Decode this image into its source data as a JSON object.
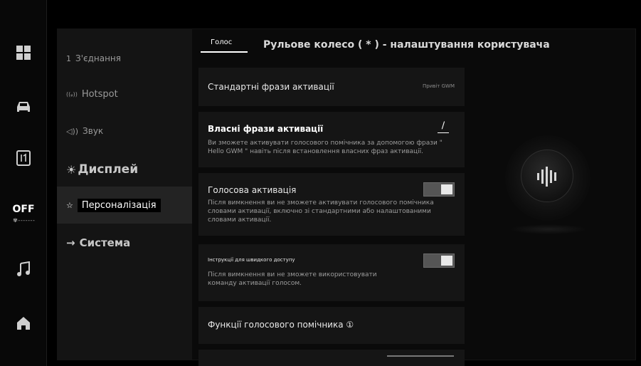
{
  "rail": {
    "ac_status": "OFF",
    "ac_fan_dots": "✾ - - - - - - -"
  },
  "menu": {
    "items": [
      {
        "label": "З'єднання",
        "icon_text": "1"
      },
      {
        "label": "Hotspot",
        "icon_text": "((ᵩ))"
      },
      {
        "label": "Звук",
        "icon_text": "◁))"
      },
      {
        "label": "Дисплей",
        "icon_text": "☀"
      },
      {
        "label": "Персоналізація",
        "icon_text": "☆"
      },
      {
        "label": "Система",
        "icon_text": "→"
      }
    ]
  },
  "header": {
    "tab_label": "Голос",
    "title": "Рульове колесо ( * ) - налаштування користувача"
  },
  "cards": {
    "standard_phrases": {
      "title": "Стандартні фрази активації",
      "value": "Привіт GWM"
    },
    "custom_phrases": {
      "title": "Власні фрази активації",
      "edit_glyph": "∕",
      "desc": "Ви зможете активувати голосового помічника за допомогою фрази \" Hello GWM \" навіть після встановлення власних фраз активації."
    },
    "voice_activation": {
      "title": "Голосова активація",
      "desc": "Після вимкнення ви не зможете активувати голосового помічника словами активації, включно зі стандартними або налаштованими словами активації.",
      "enabled": true
    },
    "quick_access": {
      "title": "Інструкції для швидкого доступу",
      "desc": "Після вимкнення ви не зможете використовувати команду активації голосом.",
      "enabled": true
    },
    "assistant_functions": {
      "title": "Функції голосового помічника ①"
    }
  },
  "colors": {
    "background": "#000000",
    "panel": "#141414",
    "card": "#151515",
    "selected": "#232323",
    "toggle_on": "#e8e8e8"
  }
}
